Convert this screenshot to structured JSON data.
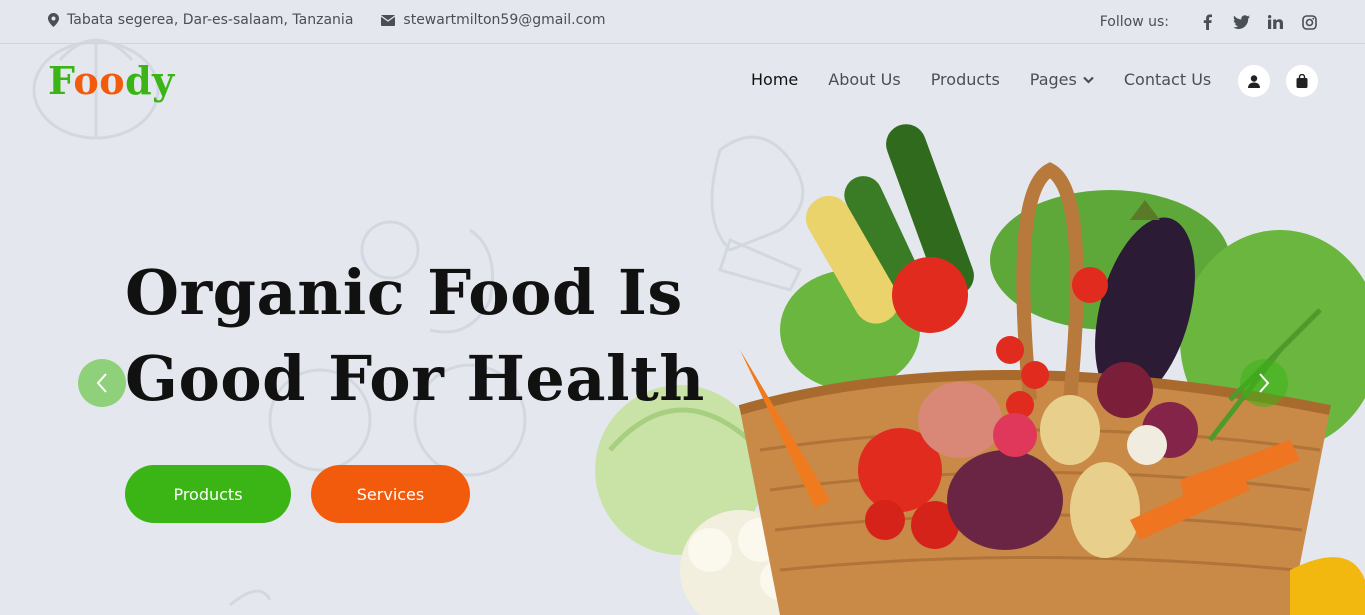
{
  "topbar": {
    "address": "Tabata segerea, Dar-es-salaam, Tanzania",
    "email": "stewartmilton59@gmail.com",
    "follow_label": "Follow us:",
    "socials": [
      "facebook-icon",
      "twitter-icon",
      "linkedin-icon",
      "instagram-icon"
    ]
  },
  "brand": {
    "logo_part1": "F",
    "logo_part2": "oo",
    "logo_part3": "dy",
    "color_green": "#3bb515",
    "color_orange": "#f25a0c"
  },
  "nav": {
    "items": [
      {
        "label": "Home",
        "active": true
      },
      {
        "label": "About Us"
      },
      {
        "label": "Products"
      },
      {
        "label": "Pages",
        "dropdown": true
      },
      {
        "label": "Contact Us"
      }
    ],
    "icons": [
      "user-icon",
      "shopping-bag-icon"
    ]
  },
  "hero": {
    "title_line1": "Organic Food Is",
    "title_line2": "Good For Health",
    "btn_products": "Products",
    "btn_services": "Services",
    "prev_icon": "chevron-left-icon",
    "next_icon": "chevron-right-icon"
  }
}
